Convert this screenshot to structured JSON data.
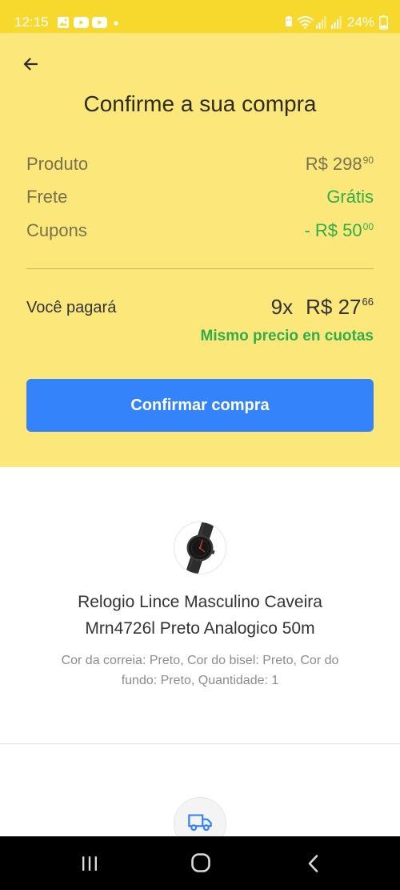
{
  "colors": {
    "status_yellow": "#f6d92c",
    "panel_yellow": "#fbe77a",
    "accent_blue": "#3483fa",
    "success_green": "#2fae4c"
  },
  "status_bar": {
    "time": "12:15",
    "battery": "24%",
    "battery_level": 24,
    "left_icons": [
      "gallery-icon",
      "youtube-icon",
      "youtube-icon",
      "notification-dot-icon"
    ],
    "right_icons": [
      "status-app-icon",
      "wifi-icon",
      "signal-icon",
      "signal-icon",
      "battery-icon"
    ]
  },
  "header": {
    "back_icon": "arrow-left-icon",
    "title": "Confirme a sua compra"
  },
  "summary": {
    "product": {
      "label": "Produto",
      "amount": "R$ 298",
      "cents": "90"
    },
    "shipping": {
      "label": "Frete",
      "value": "Grátis"
    },
    "coupons": {
      "label": "Cupons",
      "amount": "- R$ 50",
      "cents": "00"
    }
  },
  "total": {
    "label": "Você pagará",
    "installments": "9x",
    "amount": "R$ 27",
    "cents": "66",
    "note": "Mismo precio en cuotas"
  },
  "confirm_button": {
    "label": "Confirmar compra"
  },
  "item": {
    "image_icon": "wristwatch-icon",
    "title_lines": [
      "Relogio Lince Masculino Caveira",
      "Mrn4726l Preto Analogico 50m"
    ],
    "attribute_lines": [
      "Cor da correia: Preto, Cor do bisel: Preto, Cor do",
      "fundo: Preto, Quantidade: 1"
    ]
  },
  "shipping_section": {
    "icon": "truck-icon"
  },
  "nav_bar": {
    "icons": [
      "recent-apps-icon",
      "home-icon",
      "back-icon"
    ]
  }
}
